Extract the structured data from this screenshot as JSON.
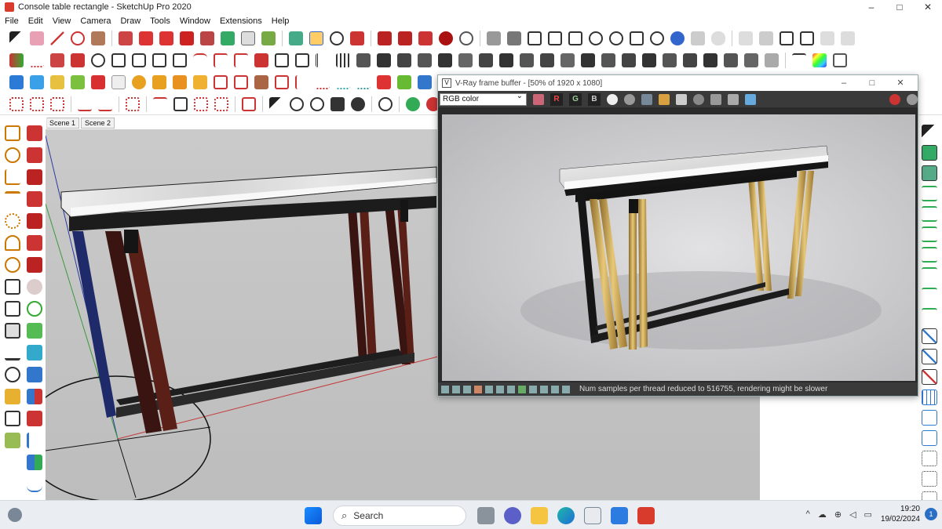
{
  "window": {
    "title": "Console table rectangle - SketchUp Pro 2020",
    "minimize": "–",
    "maximize": "□",
    "close": "✕"
  },
  "menu": [
    "File",
    "Edit",
    "View",
    "Camera",
    "Draw",
    "Tools",
    "Window",
    "Extensions",
    "Help"
  ],
  "scenes": [
    "Scene 1",
    "Scene 2"
  ],
  "vray": {
    "title": "V-Ray frame buffer - [50% of 1920 x 1080]",
    "channel_select": "RGB color",
    "channels": [
      "R",
      "G",
      "B"
    ],
    "status_message": "Num samples per thread reduced to 516755, rendering might be slower",
    "minimize": "–",
    "maximize": "□",
    "close": "✕"
  },
  "taskbar": {
    "search_label": "Search",
    "search_icon": "⌕",
    "time": "19:20",
    "date": "19/02/2024",
    "notification_count": "1",
    "tray_chevron": "^"
  },
  "colors": {
    "marble": "#d9d9d9",
    "gold": "#c9a24a",
    "brown_leg": "#4a1b14",
    "sketchup_red": "#d83b2b"
  }
}
